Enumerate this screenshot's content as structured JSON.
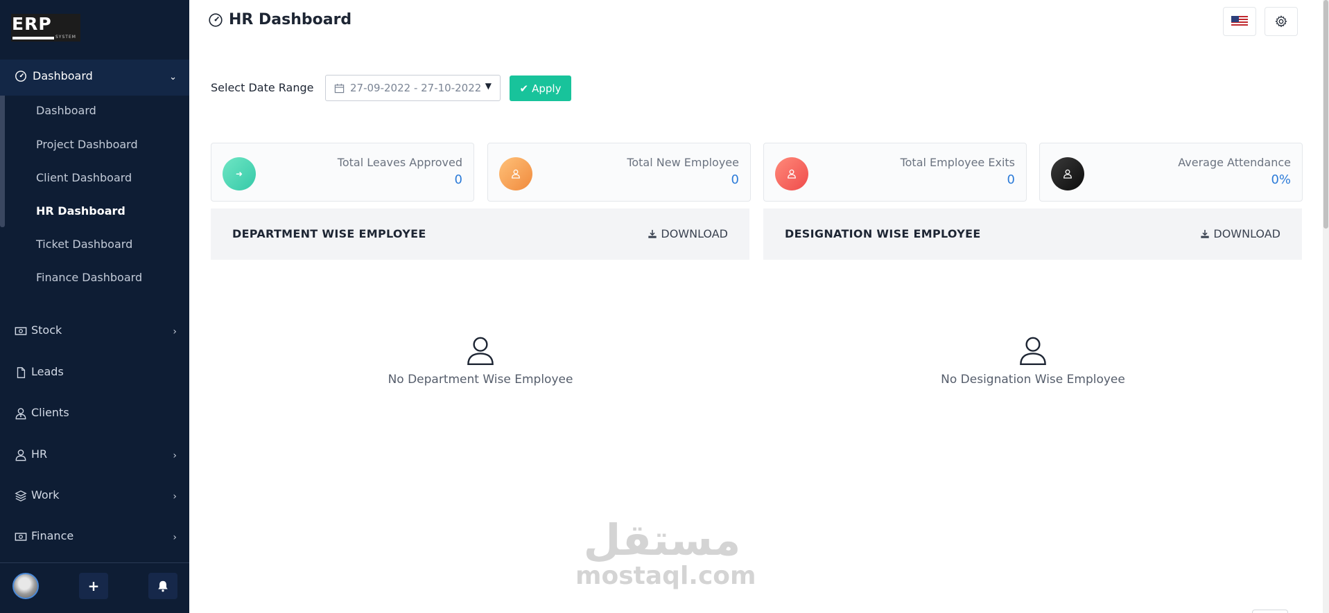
{
  "brand": {
    "logo_text": "ERP",
    "logo_sub": "SYSTEM"
  },
  "sidebar": {
    "active_group": {
      "label": "Dashboard",
      "icon": "dashboard-gauge-icon"
    },
    "sub_items": [
      {
        "label": "Dashboard",
        "active": false
      },
      {
        "label": "Project Dashboard",
        "active": false
      },
      {
        "label": "Client Dashboard",
        "active": false
      },
      {
        "label": "HR Dashboard",
        "active": true
      },
      {
        "label": "Ticket Dashboard",
        "active": false
      },
      {
        "label": "Finance Dashboard",
        "active": false
      }
    ],
    "items": [
      {
        "label": "Stock",
        "icon": "money-icon",
        "has_children": true
      },
      {
        "label": "Leads",
        "icon": "file-icon",
        "has_children": false
      },
      {
        "label": "Clients",
        "icon": "user-tie-icon",
        "has_children": false
      },
      {
        "label": "HR",
        "icon": "user-icon",
        "has_children": true
      },
      {
        "label": "Work",
        "icon": "layers-icon",
        "has_children": true
      },
      {
        "label": "Finance",
        "icon": "money-icon",
        "has_children": true
      }
    ],
    "footer": {
      "add_label": "+",
      "bell_icon": "bell-icon"
    }
  },
  "header": {
    "title": "HR Dashboard",
    "title_icon": "dashboard-gauge-icon",
    "language_flag": "us-flag-icon",
    "settings_icon": "gear-icon"
  },
  "filters": {
    "range_label": "Select Date Range",
    "date_range": "27-09-2022 - 27-10-2022",
    "apply_label": "Apply"
  },
  "stats": [
    {
      "label": "Total Leaves Approved",
      "value": "0",
      "icon": "sign-out-icon",
      "color": "#3fd5b0"
    },
    {
      "label": "Total New Employee",
      "value": "0",
      "icon": "user-icon",
      "color": "#f7a04f"
    },
    {
      "label": "Total Employee Exits",
      "value": "0",
      "icon": "user-icon",
      "color": "#f5625d"
    },
    {
      "label": "Average Attendance",
      "value": "0%",
      "icon": "user-icon",
      "color": "#1a1a1a"
    }
  ],
  "panels": [
    {
      "title": "DEPARTMENT WISE EMPLOYEE",
      "download_label": "DOWNLOAD",
      "empty_text": "No Department Wise Employee"
    },
    {
      "title": "DESIGNATION WISE EMPLOYEE",
      "download_label": "DOWNLOAD",
      "empty_text": "No Designation Wise Employee"
    }
  ],
  "watermark": {
    "arabic": "مستقل",
    "latin": "mostaql.com"
  },
  "colors": {
    "sidebar_bg": "#0e1d34",
    "accent_green": "#18c39b",
    "value_blue": "#2c7bd8"
  }
}
